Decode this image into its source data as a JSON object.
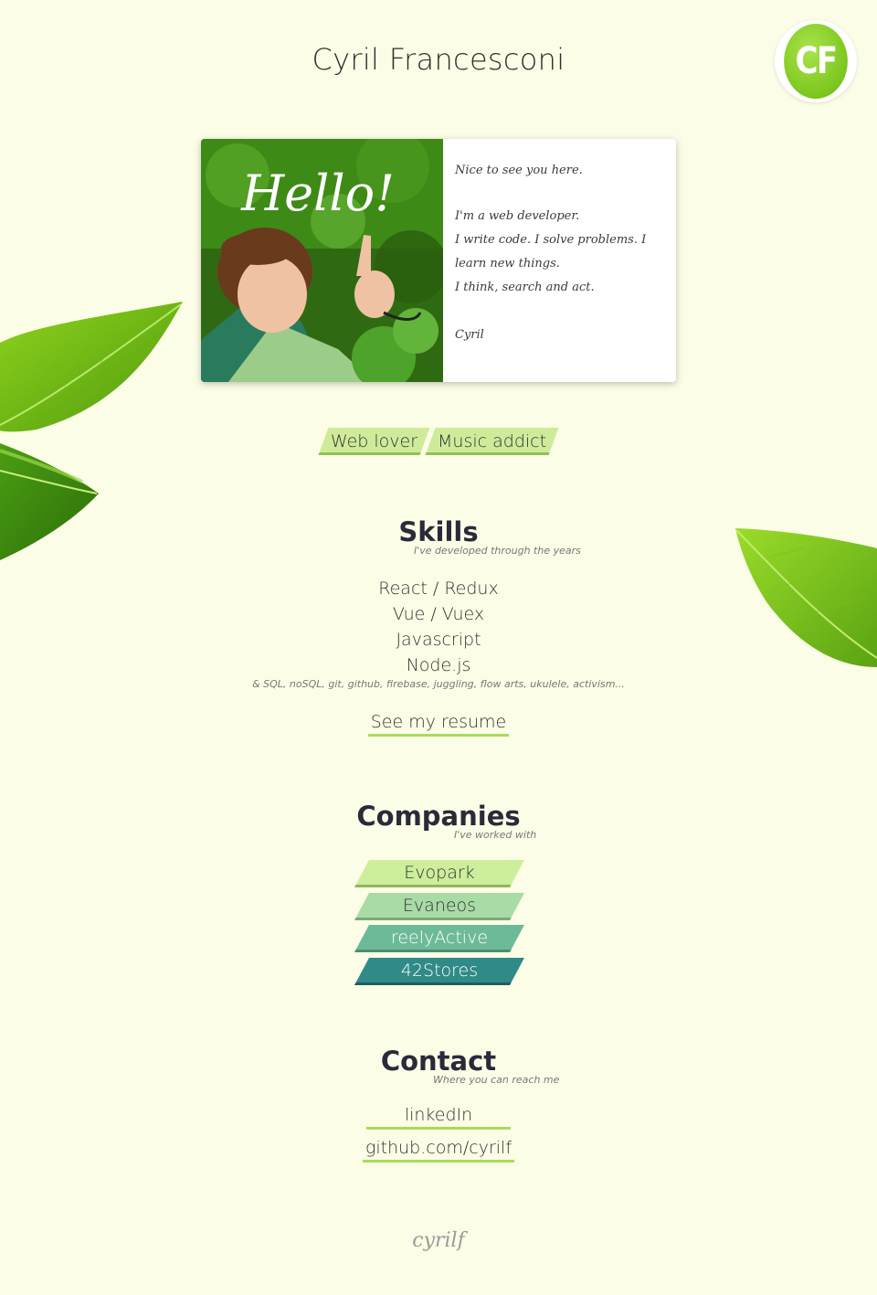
{
  "header": {
    "title": "Cyril Francesconi",
    "logo_text": "CF"
  },
  "card": {
    "hello": "Hello!",
    "greeting": "Nice to see you here.",
    "lines": [
      "I'm a web developer.",
      "I write code. I solve problems. I learn new things.",
      "I think, search and act."
    ],
    "signature": "Cyril"
  },
  "tags": [
    "Web lover",
    "Music addict"
  ],
  "skills": {
    "title": "Skills",
    "subtitle": "I've developed through the years",
    "items": [
      "React / Redux",
      "Vue / Vuex",
      "Javascript",
      "Node.js"
    ],
    "extra": "& SQL, noSQL, git, github, firebase, juggling, flow arts, ukulele, activism...",
    "resume_link": "See my resume"
  },
  "companies": {
    "title": "Companies",
    "subtitle": "I've worked with",
    "items": [
      {
        "name": "Evopark",
        "bg": "#cdee9a",
        "border": "#8fb85a",
        "fg": "#333333"
      },
      {
        "name": "Evaneos",
        "bg": "#a8dba6",
        "border": "#78ab78",
        "fg": "#333333"
      },
      {
        "name": "reelyActive",
        "bg": "#6dba98",
        "border": "#4a8d74",
        "fg": "#ffffff"
      },
      {
        "name": "42Stores",
        "bg": "#2f8a88",
        "border": "#1d5e5c",
        "fg": "#ffffff"
      }
    ]
  },
  "contact": {
    "title": "Contact",
    "subtitle": "Where you can reach me",
    "links": [
      "linkedIn",
      "github.com/cyrilf"
    ]
  },
  "footer": {
    "signature": "cyrilf"
  },
  "colors": {
    "background": "#fcfde6",
    "accent": "#a8dc5a",
    "logo": "#7cc61e"
  }
}
